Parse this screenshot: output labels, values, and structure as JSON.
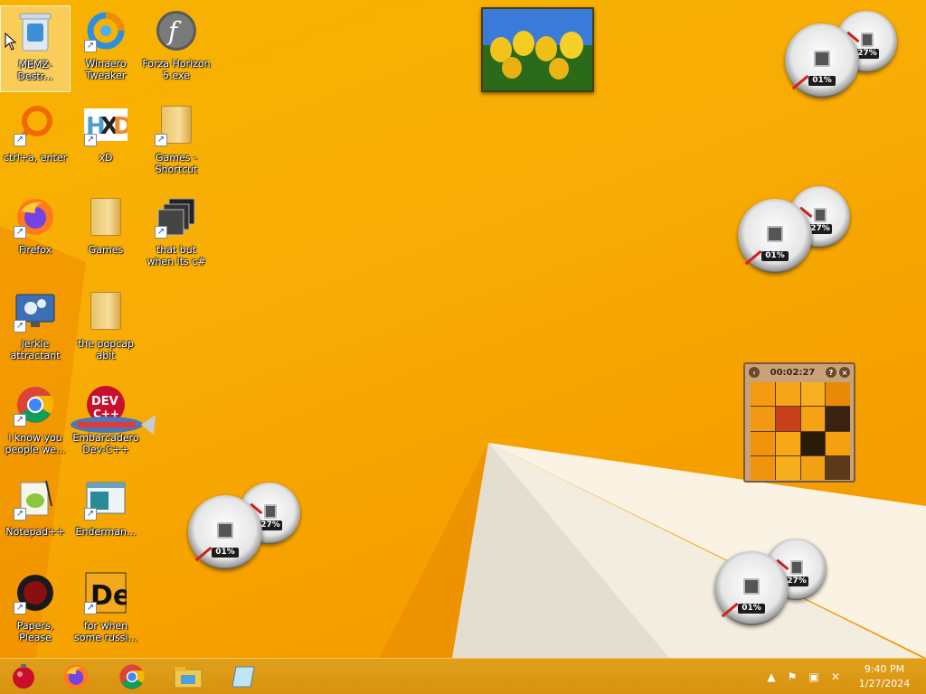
{
  "desktop": {
    "icons": [
      {
        "label": "MEMZ-Destr...",
        "icon": "recycle-bin-icon"
      },
      {
        "label": "Winaero Tweaker",
        "icon": "winaero-tweaker-icon"
      },
      {
        "label": "Forza Horizon 5.exe",
        "icon": "flash-player-icon"
      },
      {
        "label": "ctrl+a, enter",
        "icon": "search-lens-icon"
      },
      {
        "label": "xD",
        "icon": "hxd-hex-editor-icon"
      },
      {
        "label": "Games - Shortcut",
        "icon": "folder-icon"
      },
      {
        "label": "Firefox",
        "icon": "firefox-icon"
      },
      {
        "label": "Games",
        "icon": "folder-icon"
      },
      {
        "label": "that but when its c#",
        "icon": "stacked-windows-icon"
      },
      {
        "label": "jerkie attractant",
        "icon": "monitor-gear-icon"
      },
      {
        "label": "the popcap abit",
        "icon": "folder-icon"
      },
      {
        "label": "i know you people we...",
        "icon": "chrome-icon"
      },
      {
        "label": "Embarcadero Dev-C++",
        "icon": "dev-cpp-icon"
      },
      {
        "label": "Notepad++",
        "icon": "notepad-plus-plus-icon"
      },
      {
        "label": "Enderman...",
        "icon": "window-icon"
      },
      {
        "label": "Papers, Please",
        "icon": "papers-please-icon"
      },
      {
        "label": "for when some russi...",
        "icon": "de-icon"
      }
    ]
  },
  "gadgets": {
    "cpu_meters": [
      {
        "cpu": "01%",
        "ram": "27%"
      },
      {
        "cpu": "01%",
        "ram": "27%"
      },
      {
        "cpu": "01%",
        "ram": "27%"
      },
      {
        "cpu": "01%",
        "ram": "27%"
      }
    ],
    "puzzle": {
      "timer": "00:02:27",
      "help": "?",
      "close": "×"
    }
  },
  "taskbar": {
    "apps": [
      "start-ornament-icon",
      "firefox-icon",
      "chrome-icon",
      "file-explorer-icon",
      "notepad-icon"
    ],
    "tray": [
      "show-hidden-icons-icon",
      "action-center-flag-icon",
      "network-icon",
      "volume-muted-icon"
    ],
    "clock": {
      "time": "9:40 PM",
      "date": "1/27/2024"
    }
  },
  "colors": {
    "wallpaper": "#f8ad05",
    "taskbar": "#d89210",
    "gauge_red": "#d41f1f"
  }
}
